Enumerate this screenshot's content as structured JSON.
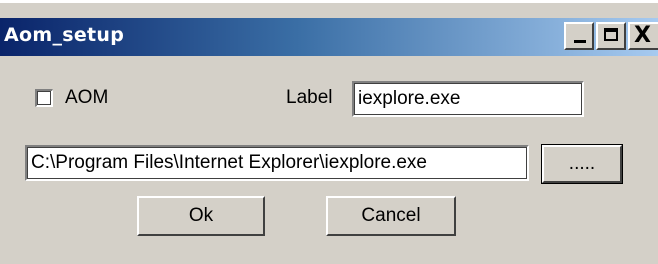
{
  "window": {
    "title": "Aom_setup",
    "controls": {
      "minimize_icon": "minimize-icon",
      "maximize_icon": "maximize-icon",
      "close_icon": "close-icon",
      "close_glyph": "X"
    }
  },
  "form": {
    "aom_checkbox": {
      "label": "AOM",
      "checked": false
    },
    "label_field": {
      "caption": "Label",
      "value": "iexplore.exe"
    },
    "path_field": {
      "value": "C:\\Program Files\\Internet Explorer\\iexplore.exe"
    },
    "browse_button": {
      "label": "....."
    },
    "ok_button": {
      "label": "Ok"
    },
    "cancel_button": {
      "label": "Cancel"
    }
  },
  "colors": {
    "titlebar_start": "#0a246a",
    "titlebar_end": "#a6caf0",
    "dialog_background": "#d4d0c8"
  }
}
